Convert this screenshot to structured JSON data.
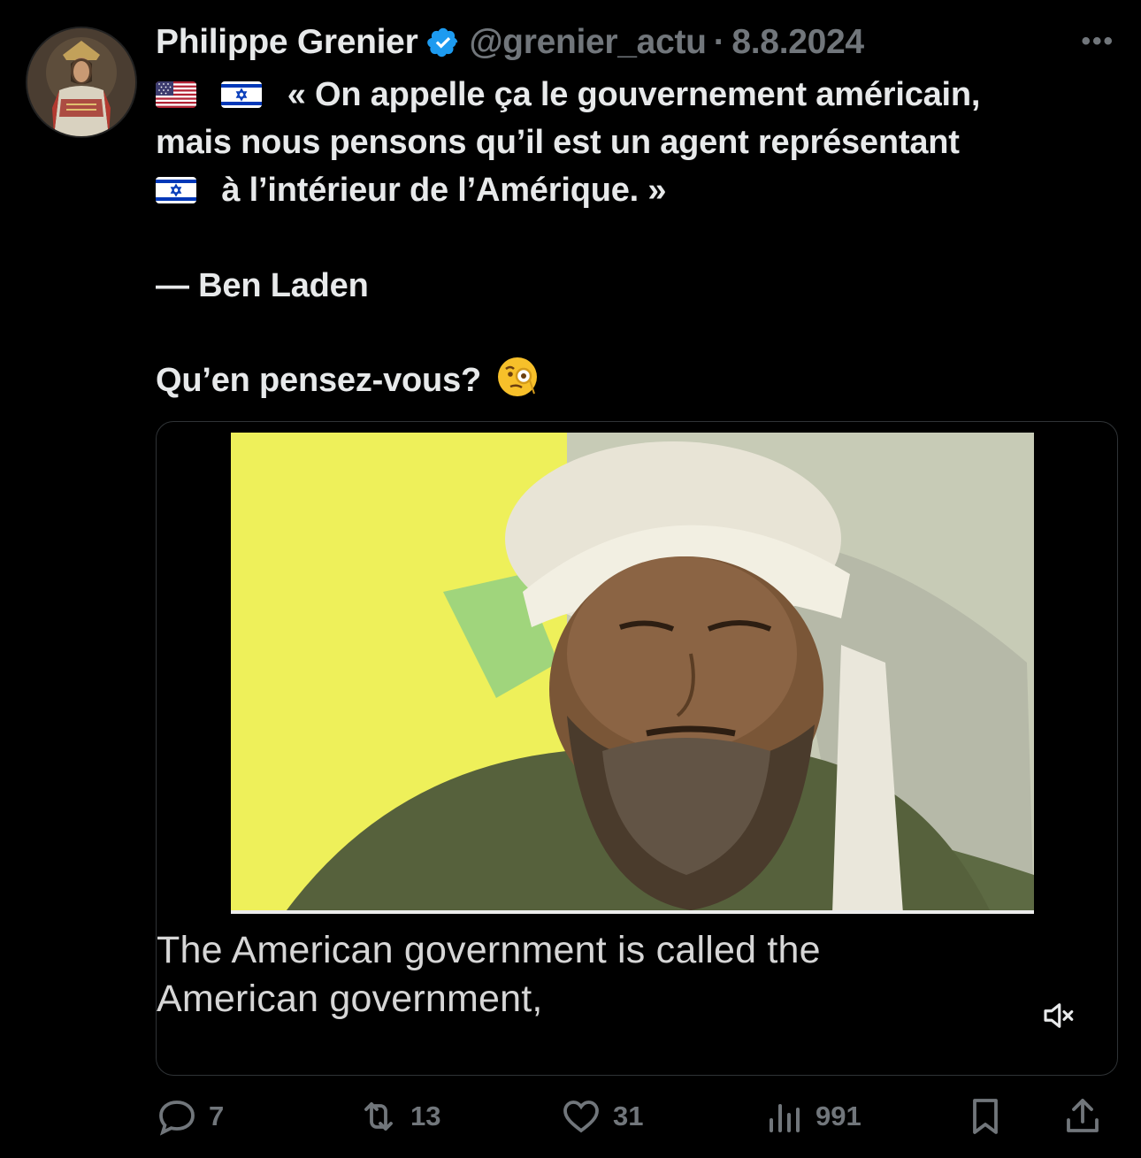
{
  "tweet": {
    "author_name": "Philippe Grenier",
    "handle": "@grenier_actu",
    "separator": "·",
    "date": "8.8.2024",
    "more_icon": "more-horizontal-icon",
    "text": {
      "line1": "« On appelle ça le gouvernement américain,",
      "line2": "mais nous pensons qu’il est un agent représentant",
      "line3": "à l’intérieur de l’Amérique. »",
      "attribution": "— Ben Laden",
      "question": "Qu’en pensez-vous?"
    }
  },
  "media": {
    "subtitle_line1": "The American government is called the",
    "subtitle_line2": "American government,",
    "mute_icon": "volume-muted-icon"
  },
  "actions": {
    "replies": "7",
    "reposts": "13",
    "likes": "31",
    "views": "991"
  },
  "colors": {
    "background": "#000000",
    "text": "#e7e9ea",
    "muted": "#71767b",
    "verified": "#1d9bf0"
  }
}
